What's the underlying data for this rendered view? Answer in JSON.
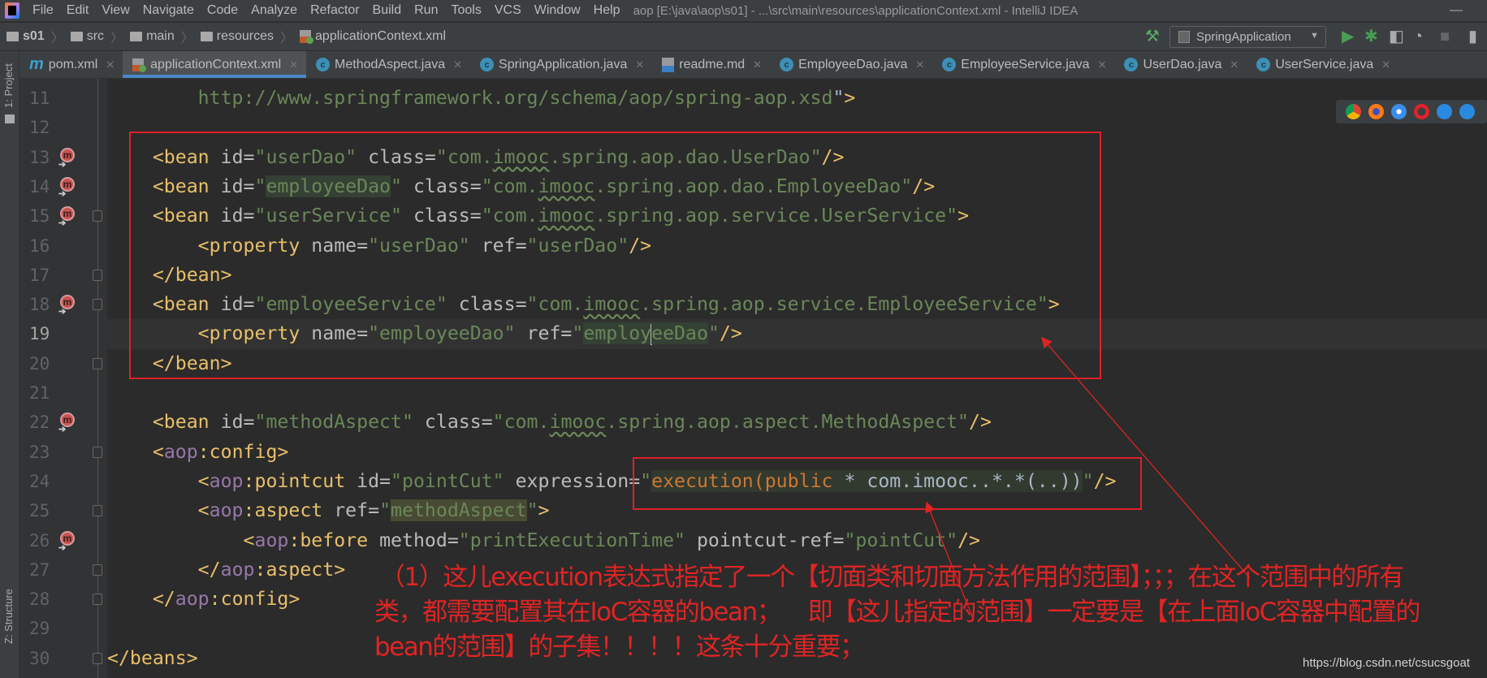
{
  "menubar": {
    "items": [
      "File",
      "Edit",
      "View",
      "Navigate",
      "Code",
      "Analyze",
      "Refactor",
      "Build",
      "Run",
      "Tools",
      "VCS",
      "Window",
      "Help"
    ],
    "window_title": "aop [E:\\java\\aop\\s01] - ...\\src\\main\\resources\\applicationContext.xml - IntelliJ IDEA"
  },
  "breadcrumb": [
    "s01",
    "src",
    "main",
    "resources",
    "applicationContext.xml"
  ],
  "run_config": "SpringApplication",
  "tabs": [
    {
      "label": "pom.xml",
      "icon": "maven-icon"
    },
    {
      "label": "applicationContext.xml",
      "icon": "xml-icon",
      "active": true
    },
    {
      "label": "MethodAspect.java",
      "icon": "class-icon"
    },
    {
      "label": "SpringApplication.java",
      "icon": "class-icon"
    },
    {
      "label": "readme.md",
      "icon": "markdown-icon"
    },
    {
      "label": "EmployeeDao.java",
      "icon": "class-icon"
    },
    {
      "label": "EmployeeService.java",
      "icon": "class-icon"
    },
    {
      "label": "UserDao.java",
      "icon": "class-icon"
    },
    {
      "label": "UserService.java",
      "icon": "class-icon"
    }
  ],
  "side_labels": {
    "project": "1: Project",
    "structure": "Z: Structure"
  },
  "editor": {
    "current_line": 19,
    "lines": [
      {
        "n": "11",
        "tokens": [
          [
            "v",
            "        http://www.springframework.org/schema/aop/spring-aop.xsd"
          ],
          [
            "p",
            "\""
          ],
          [
            "t",
            ">"
          ]
        ]
      },
      {
        "n": "12",
        "tokens": []
      },
      {
        "n": "13",
        "tokens": [
          [
            "t",
            "    <bean "
          ],
          [
            "a",
            "id="
          ],
          [
            "v",
            "\"userDao\" "
          ],
          [
            "a",
            "class="
          ],
          [
            "v",
            "\"com."
          ],
          [
            "vs",
            "imooc"
          ],
          [
            "v",
            ".spring.aop.dao.UserDao\""
          ],
          [
            "t",
            "/>"
          ]
        ]
      },
      {
        "n": "14",
        "tokens": [
          [
            "t",
            "    <bean "
          ],
          [
            "a",
            "id="
          ],
          [
            "v",
            "\""
          ],
          [
            "h1",
            "employeeDao"
          ],
          [
            "v",
            "\" "
          ],
          [
            "a",
            "class="
          ],
          [
            "v",
            "\"com."
          ],
          [
            "vs",
            "imooc"
          ],
          [
            "v",
            ".spring.aop.dao.EmployeeDao\""
          ],
          [
            "t",
            "/>"
          ]
        ]
      },
      {
        "n": "15",
        "tokens": [
          [
            "t",
            "    <bean "
          ],
          [
            "a",
            "id="
          ],
          [
            "v",
            "\"userService\" "
          ],
          [
            "a",
            "class="
          ],
          [
            "v",
            "\"com."
          ],
          [
            "vs",
            "imooc"
          ],
          [
            "v",
            ".spring.aop.service.UserService\""
          ],
          [
            "t",
            ">"
          ]
        ]
      },
      {
        "n": "16",
        "tokens": [
          [
            "t",
            "        <property "
          ],
          [
            "a",
            "name="
          ],
          [
            "v",
            "\"userDao\" "
          ],
          [
            "a",
            "ref="
          ],
          [
            "v",
            "\"userDao\""
          ],
          [
            "t",
            "/>"
          ]
        ]
      },
      {
        "n": "17",
        "tokens": [
          [
            "t",
            "    </bean>"
          ]
        ]
      },
      {
        "n": "18",
        "tokens": [
          [
            "t",
            "    <bean "
          ],
          [
            "a",
            "id="
          ],
          [
            "v",
            "\"employeeService\" "
          ],
          [
            "a",
            "class="
          ],
          [
            "v",
            "\"com."
          ],
          [
            "vs",
            "imooc"
          ],
          [
            "v",
            ".spring.aop.service.EmployeeService\""
          ],
          [
            "t",
            ">"
          ]
        ]
      },
      {
        "n": "19",
        "tokens": [
          [
            "t",
            "        <property "
          ],
          [
            "a",
            "name="
          ],
          [
            "v",
            "\"employeeDao\" "
          ],
          [
            "a",
            "ref="
          ],
          [
            "v",
            "\""
          ],
          [
            "h1",
            "employ"
          ],
          [
            "caret",
            ""
          ],
          [
            "h1",
            "eeDao"
          ],
          [
            "v",
            "\""
          ],
          [
            "t",
            "/>"
          ]
        ]
      },
      {
        "n": "20",
        "tokens": [
          [
            "t",
            "    </bean>"
          ]
        ]
      },
      {
        "n": "21",
        "tokens": []
      },
      {
        "n": "22",
        "tokens": [
          [
            "t",
            "    <bean "
          ],
          [
            "a",
            "id="
          ],
          [
            "v",
            "\"methodAspect\" "
          ],
          [
            "a",
            "class="
          ],
          [
            "v",
            "\"com."
          ],
          [
            "vs",
            "imooc"
          ],
          [
            "v",
            ".spring.aop.aspect.MethodAspect\""
          ],
          [
            "t",
            "/>"
          ]
        ]
      },
      {
        "n": "23",
        "tokens": [
          [
            "t",
            "    <"
          ],
          [
            "n",
            "aop"
          ],
          [
            "t",
            ":config>"
          ]
        ]
      },
      {
        "n": "24",
        "tokens": [
          [
            "t",
            "        <"
          ],
          [
            "n",
            "aop"
          ],
          [
            "t",
            ":pointcut "
          ],
          [
            "a",
            "id="
          ],
          [
            "v",
            "\"pointCut\" "
          ],
          [
            "a",
            "expression="
          ],
          [
            "v",
            "\""
          ],
          [
            "h3x",
            "execution(public"
          ],
          [
            "h3p",
            " * com.imooc..*.*(..))"
          ],
          [
            "v",
            "\""
          ],
          [
            "t",
            "/>"
          ]
        ]
      },
      {
        "n": "25",
        "tokens": [
          [
            "t",
            "        <"
          ],
          [
            "n",
            "aop"
          ],
          [
            "t",
            ":aspect "
          ],
          [
            "a",
            "ref="
          ],
          [
            "v",
            "\""
          ],
          [
            "h2",
            "methodAspect"
          ],
          [
            "v",
            "\""
          ],
          [
            "t",
            ">"
          ]
        ]
      },
      {
        "n": "26",
        "tokens": [
          [
            "t",
            "            <"
          ],
          [
            "n",
            "aop"
          ],
          [
            "t",
            ":before "
          ],
          [
            "a",
            "method="
          ],
          [
            "v",
            "\"printExecutionTime\" "
          ],
          [
            "a",
            "pointcut-ref="
          ],
          [
            "v",
            "\"pointCut\""
          ],
          [
            "t",
            "/>"
          ]
        ]
      },
      {
        "n": "27",
        "tokens": [
          [
            "t",
            "        </"
          ],
          [
            "n",
            "aop"
          ],
          [
            "t",
            ":aspect>"
          ]
        ]
      },
      {
        "n": "28",
        "tokens": [
          [
            "t",
            "    </"
          ],
          [
            "n",
            "aop"
          ],
          [
            "t",
            ":config>"
          ]
        ]
      },
      {
        "n": "29",
        "tokens": []
      },
      {
        "n": "30",
        "tokens": [
          [
            "t",
            "</beans>"
          ]
        ]
      }
    ],
    "bean_icon_lines": [
      "13",
      "14",
      "15",
      "18",
      "22",
      "26"
    ],
    "fold_lines": [
      "15",
      "17",
      "18",
      "20",
      "23",
      "25",
      "27",
      "28",
      "30"
    ]
  },
  "annotation": {
    "lines": [
      "（1）这儿execution表达式指定了一个【切面类和切面方法作用的范围】；；；在这个范围中的所有",
      "类，都需要配置其在IoC容器的bean；    即【这儿指定的范围】一定要是【在上面IoC容器中配置的",
      "bean的范围】的子集！！！！这条十分重要；"
    ],
    "color": "#e02424"
  },
  "watermark": "https://blog.csdn.net/csucsgoat",
  "browser_icons": [
    "chrome-icon",
    "firefox-icon",
    "safari-icon",
    "opera-icon",
    "ie-icon",
    "edge-icon"
  ]
}
